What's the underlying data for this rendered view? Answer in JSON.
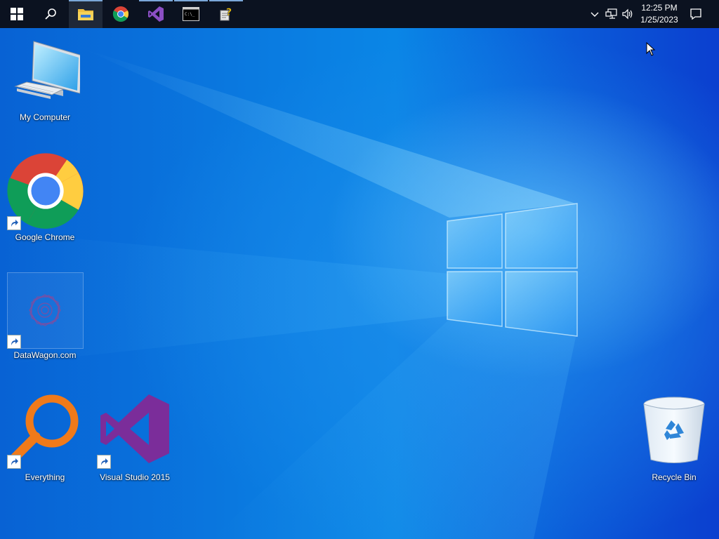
{
  "taskbar": {
    "items": [
      {
        "name": "start-button",
        "icon": "windows-logo-icon"
      },
      {
        "name": "search-button",
        "icon": "search-icon"
      },
      {
        "name": "file-explorer",
        "icon": "folder-icon"
      },
      {
        "name": "google-chrome",
        "icon": "chrome-icon"
      },
      {
        "name": "visual-studio",
        "icon": "visual-studio-icon"
      },
      {
        "name": "command-prompt",
        "icon": "terminal-icon"
      },
      {
        "name": "help-app",
        "icon": "help-icon"
      }
    ],
    "clock": {
      "time": "12:25 PM",
      "date": "1/25/2023"
    }
  },
  "desktop_icons": {
    "my_computer": "My Computer",
    "chrome": "Google Chrome",
    "datawagon": "DataWagon.com",
    "everything": "Everything",
    "visual_studio": "Visual Studio 2015",
    "recycle_bin": "Recycle Bin"
  },
  "colors": {
    "taskbar": "#0b1220",
    "desktop_accent": "#0a7ae0"
  }
}
